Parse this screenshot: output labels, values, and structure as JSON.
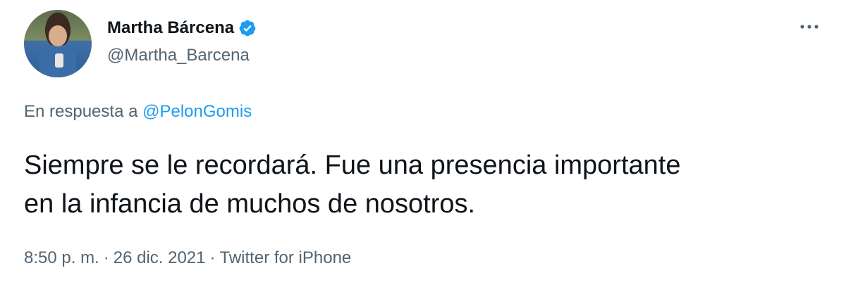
{
  "author": {
    "name": "Martha Bárcena",
    "handle": "@Martha_Barcena",
    "verified": true,
    "avatar_icon": "profile-photo"
  },
  "reply": {
    "prefix": "En respuesta a",
    "handle": "@PelonGomis"
  },
  "tweet": {
    "line1": "Siempre se le recordará. Fue una presencia importante",
    "line2": "en la infancia de muchos de nosotros."
  },
  "meta": {
    "time": "8:50 p. m.",
    "separator": "·",
    "date": "26 dic. 2021",
    "source": "Twitter for iPhone"
  },
  "colors": {
    "accent": "#1d9bf0",
    "secondary_text": "#536471",
    "primary_text": "#0f1419",
    "background": "#ffffff"
  },
  "icons": {
    "verified": "verified-badge-icon",
    "more": "more-options-icon"
  }
}
